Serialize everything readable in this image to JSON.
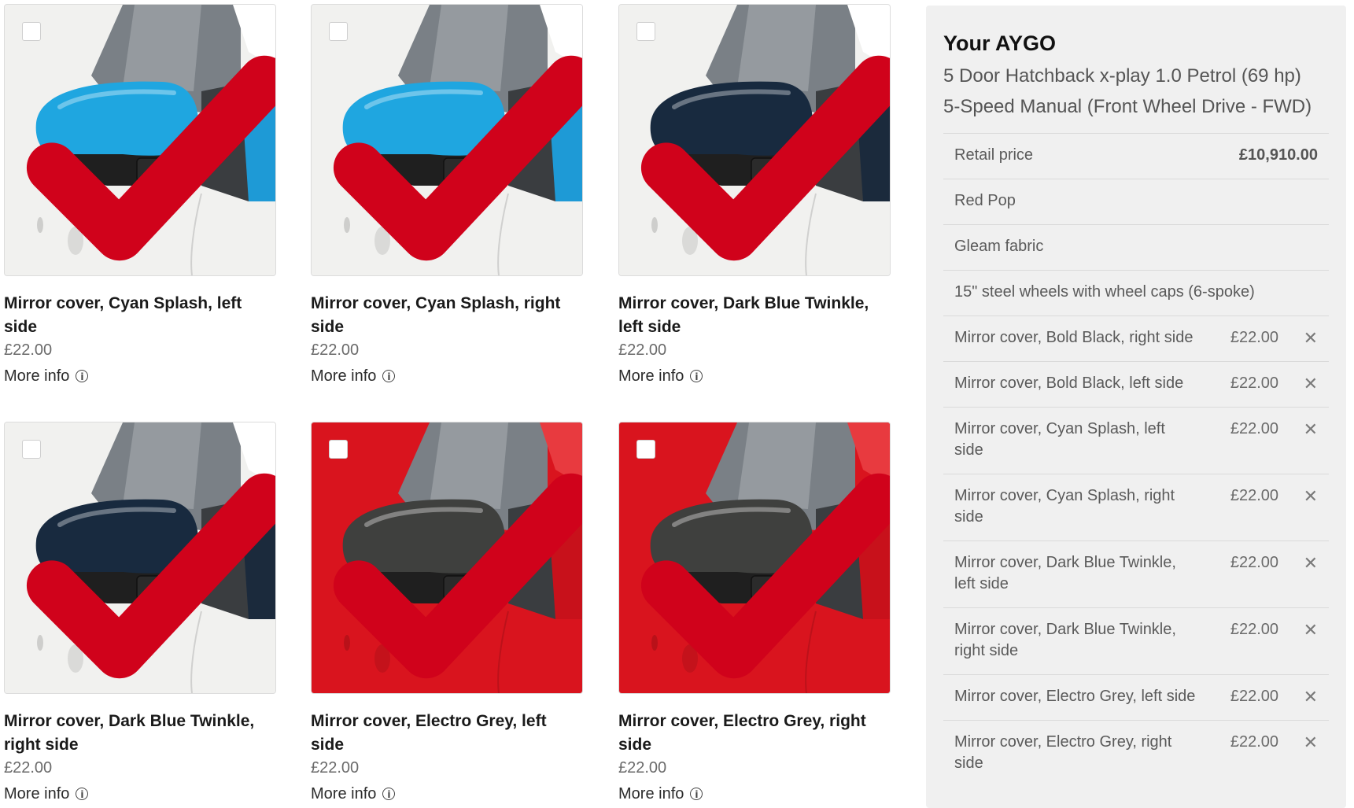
{
  "products": [
    {
      "title": "Mirror cover, Cyan Splash, left side",
      "price": "£22.00",
      "more": "More info",
      "checked": true,
      "body": "#f1f1ef",
      "mirror": "#1fa6e0",
      "pillar": "#1e9ad6"
    },
    {
      "title": "Mirror cover, Cyan Splash, right side",
      "price": "£22.00",
      "more": "More info",
      "checked": true,
      "body": "#f1f1ef",
      "mirror": "#1fa6e0",
      "pillar": "#1e9ad6"
    },
    {
      "title": "Mirror cover, Dark Blue Twinkle, left side",
      "price": "£22.00",
      "more": "More info",
      "checked": true,
      "body": "#f1f1ef",
      "mirror": "#182a3f",
      "pillar": "#1b2a3c"
    },
    {
      "title": "Mirror cover, Dark Blue Twinkle, right side",
      "price": "£22.00",
      "more": "More info",
      "checked": true,
      "body": "#f1f1ef",
      "mirror": "#182a3f",
      "pillar": "#1b2a3c"
    },
    {
      "title": "Mirror cover, Electro Grey, left side",
      "price": "£22.00",
      "more": "More info",
      "checked": true,
      "body": "#d9141e",
      "mirror": "#3f403e",
      "pillar": "#c8111b"
    },
    {
      "title": "Mirror cover, Electro Grey, right side",
      "price": "£22.00",
      "more": "More info",
      "checked": true,
      "body": "#d9141e",
      "mirror": "#3f403e",
      "pillar": "#c8111b"
    }
  ],
  "summary": {
    "title": "Your AYGO",
    "spec_line1": "5 Door Hatchback x-play 1.0 Petrol (69 hp)",
    "spec_line2": "5-Speed Manual (Front Wheel Drive - FWD)",
    "rows": [
      {
        "label": "Retail price",
        "value": "£10,910.00",
        "bold": true,
        "removable": false
      },
      {
        "label": "Red Pop",
        "value": "",
        "removable": false
      },
      {
        "label": "Gleam fabric",
        "value": "",
        "removable": false
      },
      {
        "label": "15\" steel wheels with wheel caps (6-spoke)",
        "value": "",
        "removable": false
      },
      {
        "label": "Mirror cover, Bold Black, right side",
        "value": "£22.00",
        "removable": true
      },
      {
        "label": "Mirror cover, Bold Black, left side",
        "value": "£22.00",
        "removable": true
      },
      {
        "label": "Mirror cover, Cyan Splash, left side",
        "value": "£22.00",
        "removable": true
      },
      {
        "label": "Mirror cover, Cyan Splash, right side",
        "value": "£22.00",
        "removable": true
      },
      {
        "label": "Mirror cover, Dark Blue Twinkle, left side",
        "value": "£22.00",
        "removable": true
      },
      {
        "label": "Mirror cover, Dark Blue Twinkle, right side",
        "value": "£22.00",
        "removable": true
      },
      {
        "label": "Mirror cover, Electro Grey, left side",
        "value": "£22.00",
        "removable": true
      },
      {
        "label": "Mirror cover, Electro Grey, right side",
        "value": "£22.00",
        "removable": true
      }
    ],
    "remove_glyph": "✕"
  },
  "colors": {
    "check": "#d0021b",
    "panel_bg": "#f0f0f0"
  }
}
